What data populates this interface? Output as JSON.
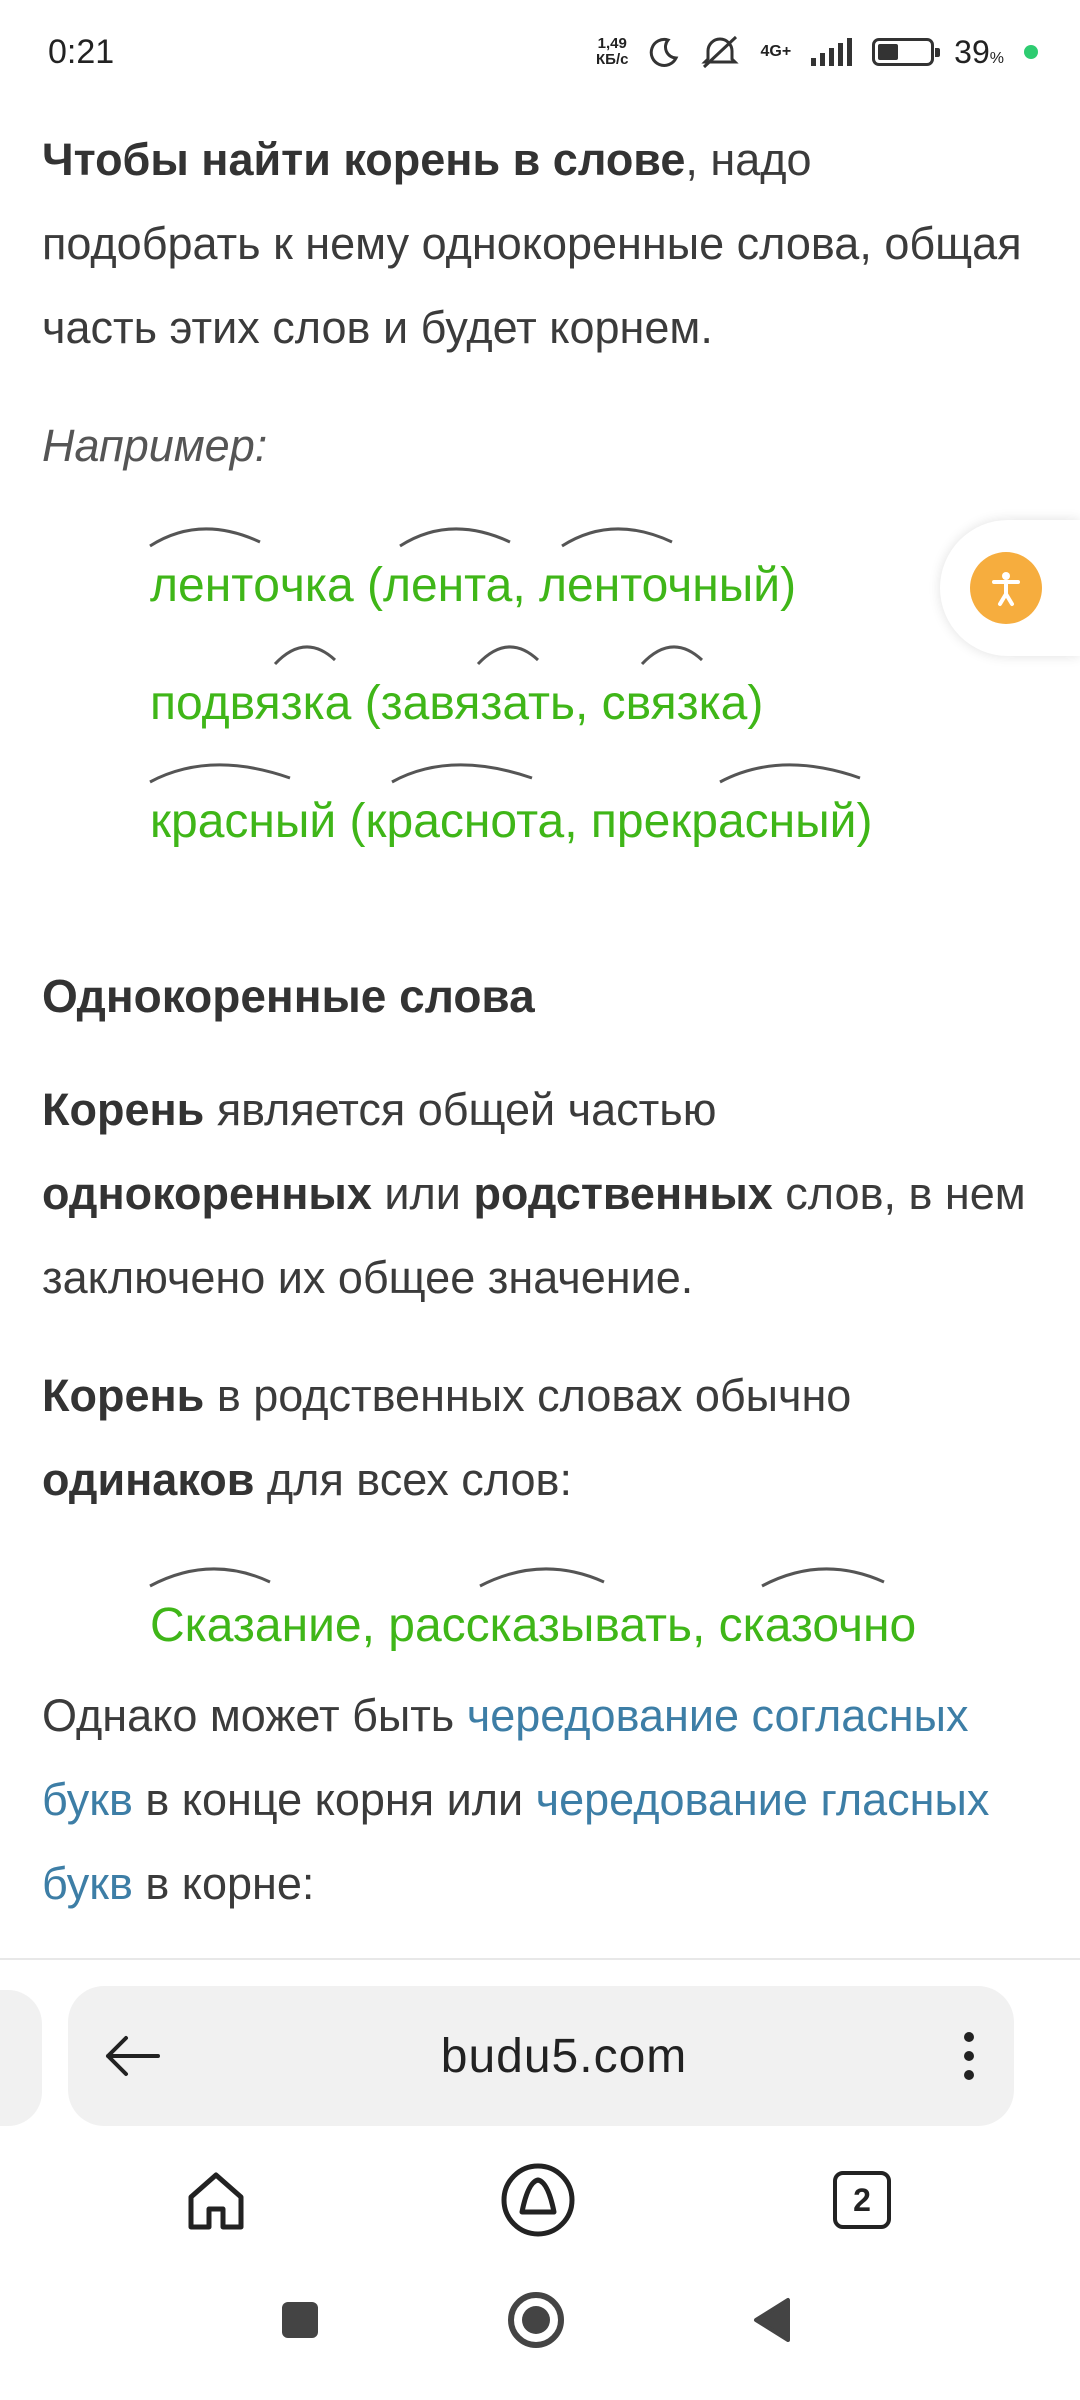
{
  "status": {
    "time": "0:21",
    "net_speed_value": "1,49",
    "net_speed_unit": "КБ/с",
    "network": "4G+",
    "battery_percent": "39",
    "battery_unit": "%",
    "battery_level": 0.39
  },
  "article": {
    "intro_bold": "Чтобы найти корень в слове",
    "intro_rest": ", надо подобрать к нему однокоренные слова, общая часть этих слов и будет корнем.",
    "example_label": "Например:",
    "examples": [
      "лентoчка (лента, ленточный)",
      "подвязка (завязать, связка)",
      "красный (краснота, прекрасный)"
    ],
    "section_title": "Однокоренные слова",
    "p1_bold1": "Корень",
    "p1_t1": " является общей частью ",
    "p1_bold2": "однокоренных",
    "p1_t2": " или ",
    "p1_bold3": "родственных",
    "p1_t3": " слов, в нем заключено их общее значение.",
    "p2_bold1": "Корень",
    "p2_t1": " в родственных словах обычно ",
    "p2_bold2": "одинаков",
    "p2_t2": " для всех слов:",
    "example2": "Сказание, рассказывать, сказочно",
    "p3_t1": "Однако может быть ",
    "p3_link1": "чередование согласных букв",
    "p3_t2": " в конце корня или ",
    "p3_link2": "чередование гласных букв",
    "p3_t3": " в корне:"
  },
  "browser": {
    "url": "budu5.com",
    "tabs_count": "2"
  },
  "colors": {
    "example_green": "#3fb618",
    "link_blue": "#3d7ea6",
    "accessibility_orange": "#f6ad3e"
  },
  "icons": [
    "back-arrow-icon",
    "more-vert-icon",
    "home-icon",
    "assistant-icon",
    "tabs-icon",
    "recents-square-icon",
    "home-circle-icon",
    "back-triangle-icon",
    "accessibility-icon",
    "moon-icon",
    "mute-icon",
    "signal-icon",
    "battery-icon"
  ]
}
